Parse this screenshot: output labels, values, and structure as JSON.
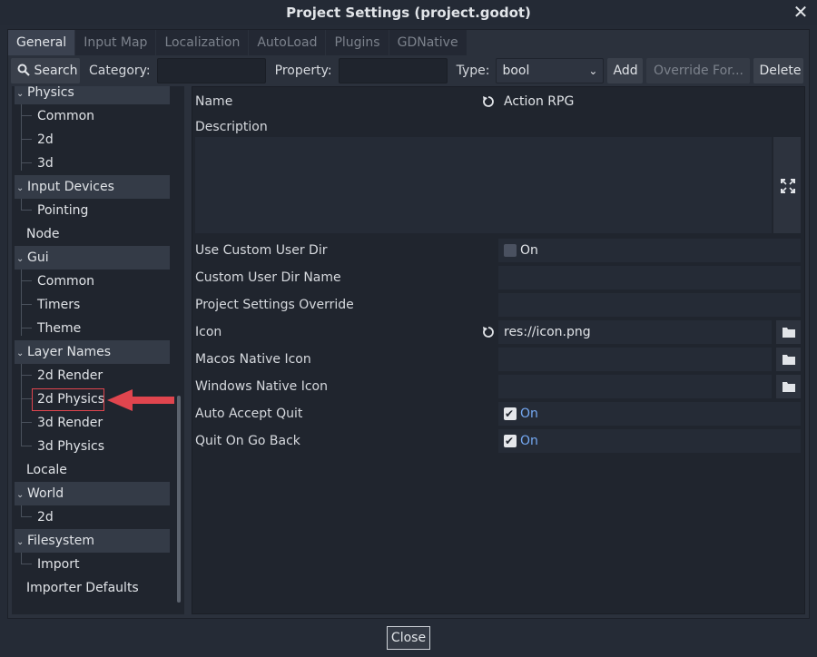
{
  "window": {
    "title": "Project Settings (project.godot)",
    "close_glyph": "✕"
  },
  "tabs": [
    {
      "label": "General",
      "active": true
    },
    {
      "label": "Input Map",
      "active": false
    },
    {
      "label": "Localization",
      "active": false
    },
    {
      "label": "AutoLoad",
      "active": false
    },
    {
      "label": "Plugins",
      "active": false
    },
    {
      "label": "GDNative",
      "active": false
    }
  ],
  "toolbar": {
    "search_label": "Search",
    "category_label": "Category:",
    "category_value": "",
    "property_label": "Property:",
    "property_value": "",
    "type_label": "Type:",
    "type_value": "bool",
    "add_label": "Add",
    "override_label": "Override For...",
    "delete_label": "Delete"
  },
  "tree": {
    "physics": "Physics",
    "physics_common": "Common",
    "physics_2d": "2d",
    "physics_3d": "3d",
    "input_devices": "Input Devices",
    "pointing": "Pointing",
    "node": "Node",
    "gui": "Gui",
    "gui_common": "Common",
    "gui_timers": "Timers",
    "gui_theme": "Theme",
    "layer_names": "Layer Names",
    "ln_2d_render": "2d Render",
    "ln_2d_physics": "2d Physics",
    "ln_3d_render": "3d Render",
    "ln_3d_physics": "3d Physics",
    "locale": "Locale",
    "world": "World",
    "world_2d": "2d",
    "filesystem": "Filesystem",
    "import": "Import",
    "importer_defaults": "Importer Defaults"
  },
  "inspector": {
    "name_label": "Name",
    "name_value": "Action RPG",
    "description_label": "Description",
    "description_value": "",
    "use_custom_user_dir_label": "Use Custom User Dir",
    "use_custom_user_dir_value": "On",
    "custom_user_dir_name_label": "Custom User Dir Name",
    "project_settings_override_label": "Project Settings Override",
    "icon_label": "Icon",
    "icon_value": "res://icon.png",
    "macos_native_icon_label": "Macos Native Icon",
    "windows_native_icon_label": "Windows Native Icon",
    "auto_accept_quit_label": "Auto Accept Quit",
    "auto_accept_quit_value": "On",
    "quit_on_go_back_label": "Quit On Go Back",
    "quit_on_go_back_value": "On"
  },
  "footer": {
    "close_label": "Close"
  },
  "colors": {
    "highlight": "#e0454e",
    "on_blue": "#74a8f2"
  }
}
